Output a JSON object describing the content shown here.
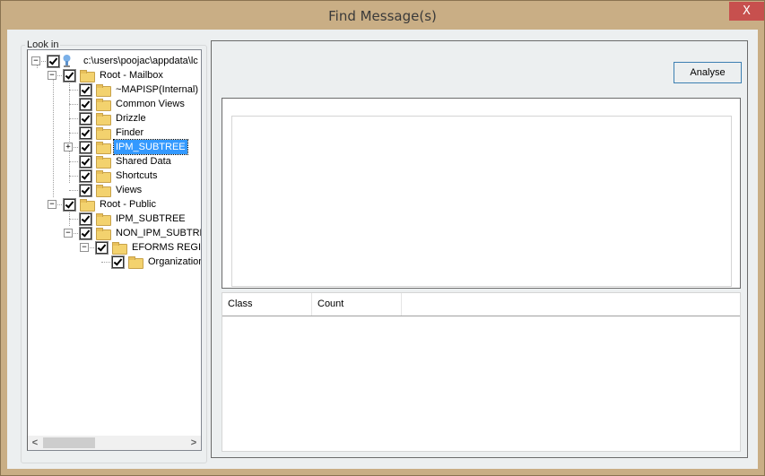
{
  "window": {
    "title": "Find Message(s)",
    "close_label": "X"
  },
  "look_in": {
    "group_label": "Look in",
    "tree": [
      {
        "label": "c:\\users\\poojac\\appdata\\lc",
        "icon": "computer-icon",
        "expander": "−",
        "checked": true,
        "selected": false
      },
      {
        "label": "Root - Mailbox",
        "icon": "folder-icon",
        "expander": "−",
        "checked": true,
        "selected": false
      },
      {
        "label": "~MAPISP(Internal)",
        "icon": "folder-icon",
        "expander": "",
        "checked": true,
        "selected": false
      },
      {
        "label": "Common Views",
        "icon": "folder-icon",
        "expander": "",
        "checked": true,
        "selected": false
      },
      {
        "label": "Drizzle",
        "icon": "folder-icon",
        "expander": "",
        "checked": true,
        "selected": false
      },
      {
        "label": "Finder",
        "icon": "folder-icon",
        "expander": "",
        "checked": true,
        "selected": false
      },
      {
        "label": "IPM_SUBTREE",
        "icon": "folder-icon",
        "expander": "+",
        "checked": true,
        "selected": true
      },
      {
        "label": "Shared Data",
        "icon": "folder-icon",
        "expander": "",
        "checked": true,
        "selected": false
      },
      {
        "label": "Shortcuts",
        "icon": "folder-icon",
        "expander": "",
        "checked": true,
        "selected": false
      },
      {
        "label": "Views",
        "icon": "folder-icon",
        "expander": "",
        "checked": true,
        "selected": false
      },
      {
        "label": "Root - Public",
        "icon": "folder-icon",
        "expander": "−",
        "checked": true,
        "selected": false
      },
      {
        "label": "IPM_SUBTREE",
        "icon": "folder-icon",
        "expander": "",
        "checked": true,
        "selected": false
      },
      {
        "label": "NON_IPM_SUBTREE",
        "icon": "folder-icon",
        "expander": "−",
        "checked": true,
        "selected": false
      },
      {
        "label": "EFORMS REGISTRY",
        "icon": "folder-icon",
        "expander": "−",
        "checked": true,
        "selected": false
      },
      {
        "label": "Organizational Forms",
        "icon": "folder-icon",
        "expander": "",
        "checked": true,
        "selected": false
      }
    ],
    "scroll_left": "<",
    "scroll_right": ">"
  },
  "actions": {
    "analyse_label": "Analyse"
  },
  "results_table": {
    "columns": [
      "Class",
      "Count"
    ],
    "rows": []
  },
  "colors": {
    "frame": "#c9ae85",
    "close_button": "#c7504e",
    "selection": "#3399ff",
    "button_border": "#3c7fb1"
  }
}
